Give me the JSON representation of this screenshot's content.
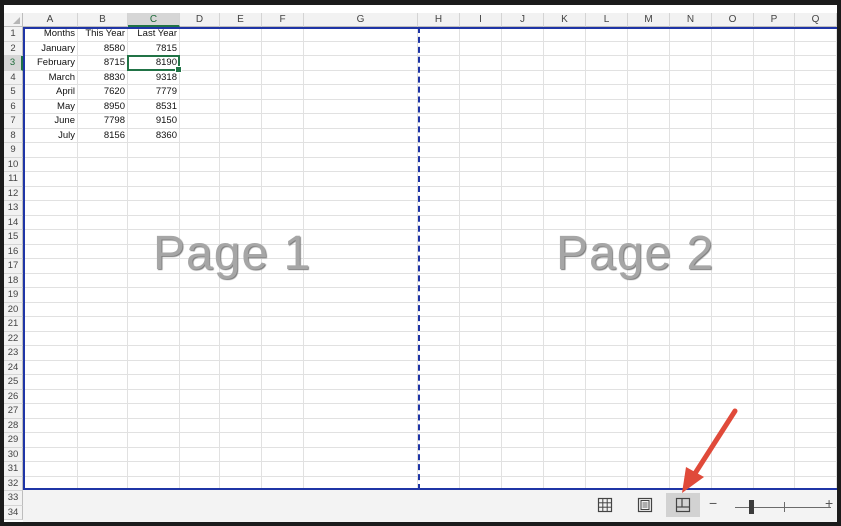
{
  "columns": [
    "A",
    "B",
    "C",
    "D",
    "E",
    "F",
    "G",
    "H",
    "I",
    "J",
    "K",
    "L",
    "M",
    "N",
    "O",
    "P",
    "Q"
  ],
  "rows": [
    "1",
    "2",
    "3",
    "4",
    "5",
    "6",
    "7",
    "8",
    "9",
    "10",
    "11",
    "12",
    "13",
    "14",
    "15",
    "16",
    "17",
    "18",
    "19",
    "20",
    "21",
    "22",
    "23",
    "24",
    "25",
    "26",
    "27",
    "28",
    "29",
    "30",
    "31",
    "32",
    "33",
    "34"
  ],
  "selected_column": "C",
  "selected_row": "3",
  "table": {
    "headers": [
      "Months",
      "This Year",
      "Last Year"
    ],
    "data": [
      [
        "January",
        "8580",
        "7815"
      ],
      [
        "February",
        "8715",
        "8190"
      ],
      [
        "March",
        "8830",
        "9318"
      ],
      [
        "April",
        "7620",
        "7779"
      ],
      [
        "May",
        "8950",
        "8531"
      ],
      [
        "June",
        "7798",
        "9150"
      ],
      [
        "July",
        "8156",
        "8360"
      ]
    ]
  },
  "watermarks": [
    "Page 1",
    "Page 2"
  ],
  "statusbar": {
    "views": [
      {
        "name": "normal-view",
        "icon": "grid-icon",
        "active": false
      },
      {
        "name": "page-layout-view",
        "icon": "page-icon",
        "active": false
      },
      {
        "name": "page-break-preview",
        "icon": "page-break-icon",
        "active": true
      }
    ],
    "zoom_minus": "−",
    "zoom_plus": "+"
  },
  "colors": {
    "page_break": "#1f35a6",
    "accent": "#217346",
    "arrow": "#e04a3a"
  }
}
